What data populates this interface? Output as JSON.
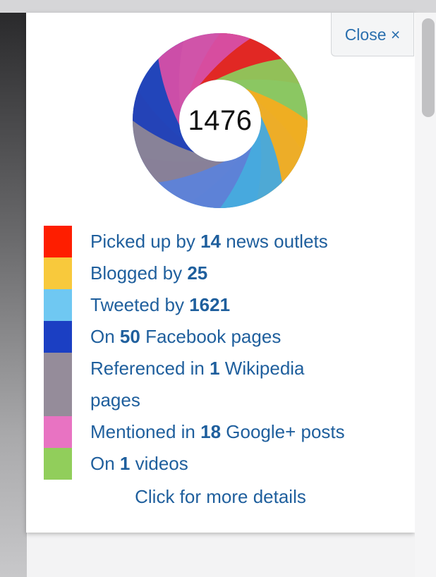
{
  "popup": {
    "close_label": "Close ×",
    "score": "1476",
    "more_details": "Click for more details"
  },
  "donut": {
    "segment_colors": [
      "#e8211a",
      "#8dc85c",
      "#f4ad1f",
      "#46a9de",
      "#5f7fd6",
      "#8a8095",
      "#1f3fb8",
      "#d64fa6"
    ]
  },
  "legend": [
    {
      "color": "#fe1e00",
      "pre": "Picked up by ",
      "num": "14",
      "post": " news outlets"
    },
    {
      "color": "#f8c93c",
      "pre": "Blogged by ",
      "num": "25",
      "post": ""
    },
    {
      "color": "#6fc8f2",
      "pre": "Tweeted by ",
      "num": "1621",
      "post": ""
    },
    {
      "color": "#1b3fc3",
      "pre": "On ",
      "num": "50",
      "post": " Facebook pages"
    },
    {
      "color": "#958c9a",
      "pre": "Referenced in ",
      "num": "1",
      "post": " Wikipedia pages"
    },
    {
      "color": "#e873c2",
      "pre": "Mentioned in ",
      "num": "18",
      "post": " Google+ posts"
    },
    {
      "color": "#91ce5b",
      "pre": "On ",
      "num": "1",
      "post": " videos"
    }
  ]
}
